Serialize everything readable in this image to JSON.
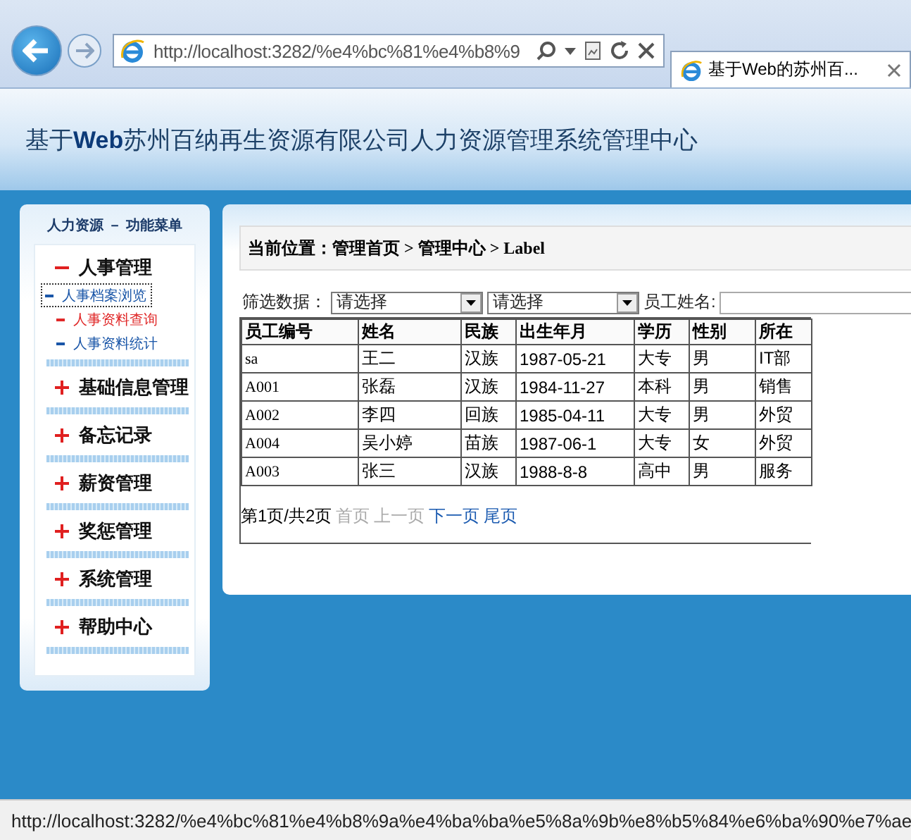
{
  "browser": {
    "address": "http://localhost:3282/%e4%bc%81%e4%b8%9",
    "tab": {
      "title": "基于Web的苏州百...",
      "selected": true
    }
  },
  "header": {
    "title": "基于**Web**苏州百纳再生资源有限公司人力资源管理系统管理中心"
  },
  "sidebar": {
    "title": "人力资源 － 功能菜单",
    "items": [
      {
        "label": "人事管理",
        "expanded": true,
        "children": [
          {
            "label": "人事档案浏览",
            "selected": true,
            "color": "#1a56a8"
          },
          {
            "label": "人事资料查询",
            "selected": false,
            "color": "#e02828"
          },
          {
            "label": "人事资料统计",
            "selected": false,
            "color": "#1a56a8"
          }
        ]
      },
      {
        "label": "基础信息管理",
        "expanded": false
      },
      {
        "label": "备忘记录",
        "expanded": false
      },
      {
        "label": "薪资管理",
        "expanded": false
      },
      {
        "label": "奖惩管理",
        "expanded": false
      },
      {
        "label": "系统管理",
        "expanded": false
      },
      {
        "label": "帮助中心",
        "expanded": false
      }
    ]
  },
  "breadcrumb": "当前位置：管理首页 > 管理中心 > Label",
  "filter": {
    "label": "筛选数据：",
    "selects": [
      {
        "value": "请选择"
      },
      {
        "value": "请选择"
      }
    ],
    "name_label": "员工姓名:"
  },
  "table": {
    "columns": [
      "员工编号",
      "姓名",
      "民族",
      "出生年月",
      "学历",
      "性别",
      "所在"
    ],
    "rows": [
      [
        "sa",
        "王二",
        "汉族",
        "1987-05-21",
        "大专",
        "男",
        "IT部"
      ],
      [
        "A001",
        "张磊",
        "汉族",
        "1984-11-27",
        "本科",
        "男",
        "销售"
      ],
      [
        "A002",
        "李四",
        "回族",
        "1985-04-11",
        "大专",
        "男",
        "外贸"
      ],
      [
        "A004",
        "吴小婷",
        "苗族",
        "1987-06-1",
        "大专",
        "女",
        "外贸"
      ],
      [
        "A003",
        "张三",
        "汉族",
        "1988-8-8",
        "高中",
        "男",
        "服务"
      ]
    ]
  },
  "pager": {
    "status": "第1页/共2页",
    "links": [
      {
        "label": "首页",
        "disabled": true
      },
      {
        "label": "上一页",
        "disabled": true
      },
      {
        "label": "下一页",
        "disabled": false
      },
      {
        "label": "尾页",
        "disabled": false
      }
    ]
  },
  "status_bar": {
    "text": "http://localhost:3282/%e4%bc%81%e4%b8%9a%e4%ba%ba%e5%8a%9b%e8%b5%84%e6%ba%90%e7%ae"
  }
}
